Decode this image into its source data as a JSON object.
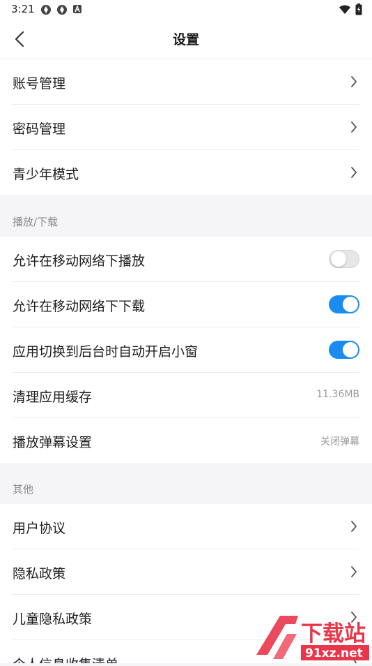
{
  "status_bar": {
    "time": "3:21"
  },
  "header": {
    "title": "设置"
  },
  "account_group": [
    {
      "label": "账号管理"
    },
    {
      "label": "密码管理"
    },
    {
      "label": "青少年模式"
    }
  ],
  "playback_section": {
    "title": "播放/下载",
    "items": [
      {
        "label": "允许在移动网络下播放",
        "toggle": "off"
      },
      {
        "label": "允许在移动网络下下载",
        "toggle": "on"
      },
      {
        "label": "应用切换到后台时自动开启小窗",
        "toggle": "on"
      },
      {
        "label": "清理应用缓存",
        "value": "11.36MB"
      },
      {
        "label": "播放弹幕设置",
        "value": "关闭弹幕"
      }
    ]
  },
  "other_section": {
    "title": "其他",
    "items": [
      {
        "label": "用户协议"
      },
      {
        "label": "隐私政策"
      },
      {
        "label": "儿童隐私政策"
      },
      {
        "label": "个人信息收集清单"
      }
    ]
  },
  "watermark": {
    "line1": "下载站",
    "line2": "91xz.net"
  },
  "colors": {
    "accent": "#1a8cf0",
    "background": "#f5f5f7",
    "watermark": "#e8364a"
  }
}
